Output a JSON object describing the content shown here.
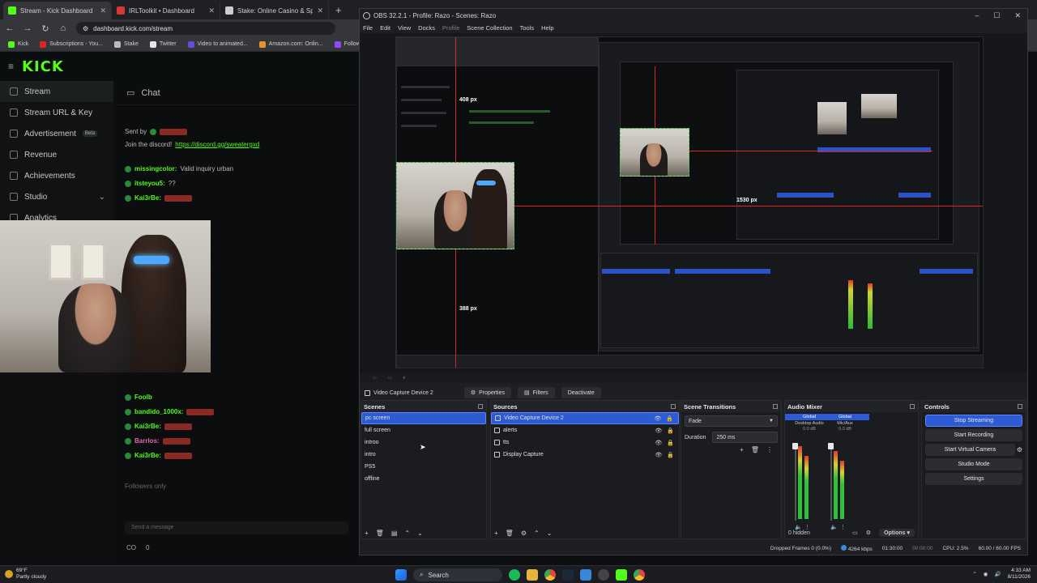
{
  "browser": {
    "tabs": [
      {
        "title": "Stream - Kick Dashboard",
        "color": "#53fc18",
        "active": true
      },
      {
        "title": "IRLToolkit • Dashboard",
        "color": "#d23a3a",
        "active": false
      },
      {
        "title": "Stake: Online Casino & Sports",
        "color": "#cccccc",
        "active": false
      }
    ],
    "url": "dashboard.kick.com/stream",
    "bookmarks": [
      "Kick",
      "Subscriptions - You...",
      "Stake",
      "Twitter",
      "Video to animated...",
      "Amazon.com: Onlin...",
      "Following"
    ]
  },
  "kick": {
    "logo": "KICK",
    "sidebar": [
      {
        "label": "Stream",
        "active": true,
        "badge": ""
      },
      {
        "label": "Stream URL & Key",
        "active": false,
        "badge": ""
      },
      {
        "label": "Advertisement",
        "active": false,
        "badge": "Beta"
      },
      {
        "label": "Revenue",
        "active": false,
        "badge": ""
      },
      {
        "label": "Achievements",
        "active": false,
        "badge": ""
      },
      {
        "label": "Studio",
        "active": false,
        "badge": ""
      },
      {
        "label": "Analytics",
        "active": false,
        "badge": ""
      }
    ],
    "chat": {
      "title": "Chat",
      "sent_by": "Sent by",
      "pinned_text": "Join the discord!",
      "pinned_link": "https://discord.gg/sweatergxd",
      "messages": [
        {
          "user": "missingcolor:",
          "text": "Valid inquiry urban"
        },
        {
          "user": "itsteyou5:",
          "text": "??"
        },
        {
          "user": "Kai3rBe:",
          "text": ""
        },
        {
          "user": "Foolb",
          "text": ""
        },
        {
          "user": "bandido_1000x:",
          "text": ""
        },
        {
          "user": "Kai3rBe:",
          "text": ""
        },
        {
          "user": "Barrlos:",
          "text": ""
        },
        {
          "user": "Kai3rBe:",
          "text": ""
        }
      ],
      "followers_only": "Followers only",
      "input_placeholder": "Send a message",
      "footer_co": "CO",
      "footer_count": "0"
    }
  },
  "obs": {
    "title": "OBS 32.2.1 - Profile: Razo - Scenes: Razo",
    "menu": [
      "File",
      "Edit",
      "View",
      "Docks",
      "Profile",
      "Scene Collection",
      "Tools",
      "Help"
    ],
    "preview_labels": {
      "top": "408 px",
      "bottom": "388 px",
      "right": "1530 px"
    },
    "context": {
      "source": "Video Capture Device 2",
      "properties": "Properties",
      "filters": "Filters",
      "deactivate": "Deactivate"
    },
    "scenes": {
      "title": "Scenes",
      "items": [
        "pc screen",
        "full screen",
        "introo",
        "intro",
        "PS5",
        "offline"
      ],
      "selected": 0
    },
    "sources": {
      "title": "Sources",
      "items": [
        "Video Capture Device 2",
        "alerts",
        "tts",
        "Display Capture"
      ],
      "selected": 0
    },
    "transitions": {
      "title": "Scene Transitions",
      "type": "Fade",
      "duration_label": "Duration",
      "duration": "250 ms"
    },
    "mixer": {
      "title": "Audio Mixer",
      "channels": [
        {
          "label": "Global",
          "name": "Desktop Audio",
          "db": "0.0 dB"
        },
        {
          "label": "Global",
          "name": "Mic/Aux",
          "db": "0.0 dB"
        }
      ],
      "hidden": "0 hidden",
      "options": "Options"
    },
    "controls": {
      "title": "Controls",
      "buttons": [
        "Stop Streaming",
        "Start Recording",
        "Start Virtual Camera",
        "Studio Mode",
        "Settings"
      ]
    },
    "status": {
      "dropped": "Dropped Frames 0 (0.0%)",
      "bitrate": "4264 kbps",
      "stream_time": "01:30:00",
      "rec_time": "00:00:00",
      "cpu": "CPU: 2.5%",
      "fps": "60.00 / 60.00 FPS"
    }
  },
  "taskbar": {
    "weather_temp": "69°F",
    "weather_desc": "Partly cloudy",
    "search": "Search",
    "time": "4:33 AM",
    "date": "8/11/2026"
  }
}
